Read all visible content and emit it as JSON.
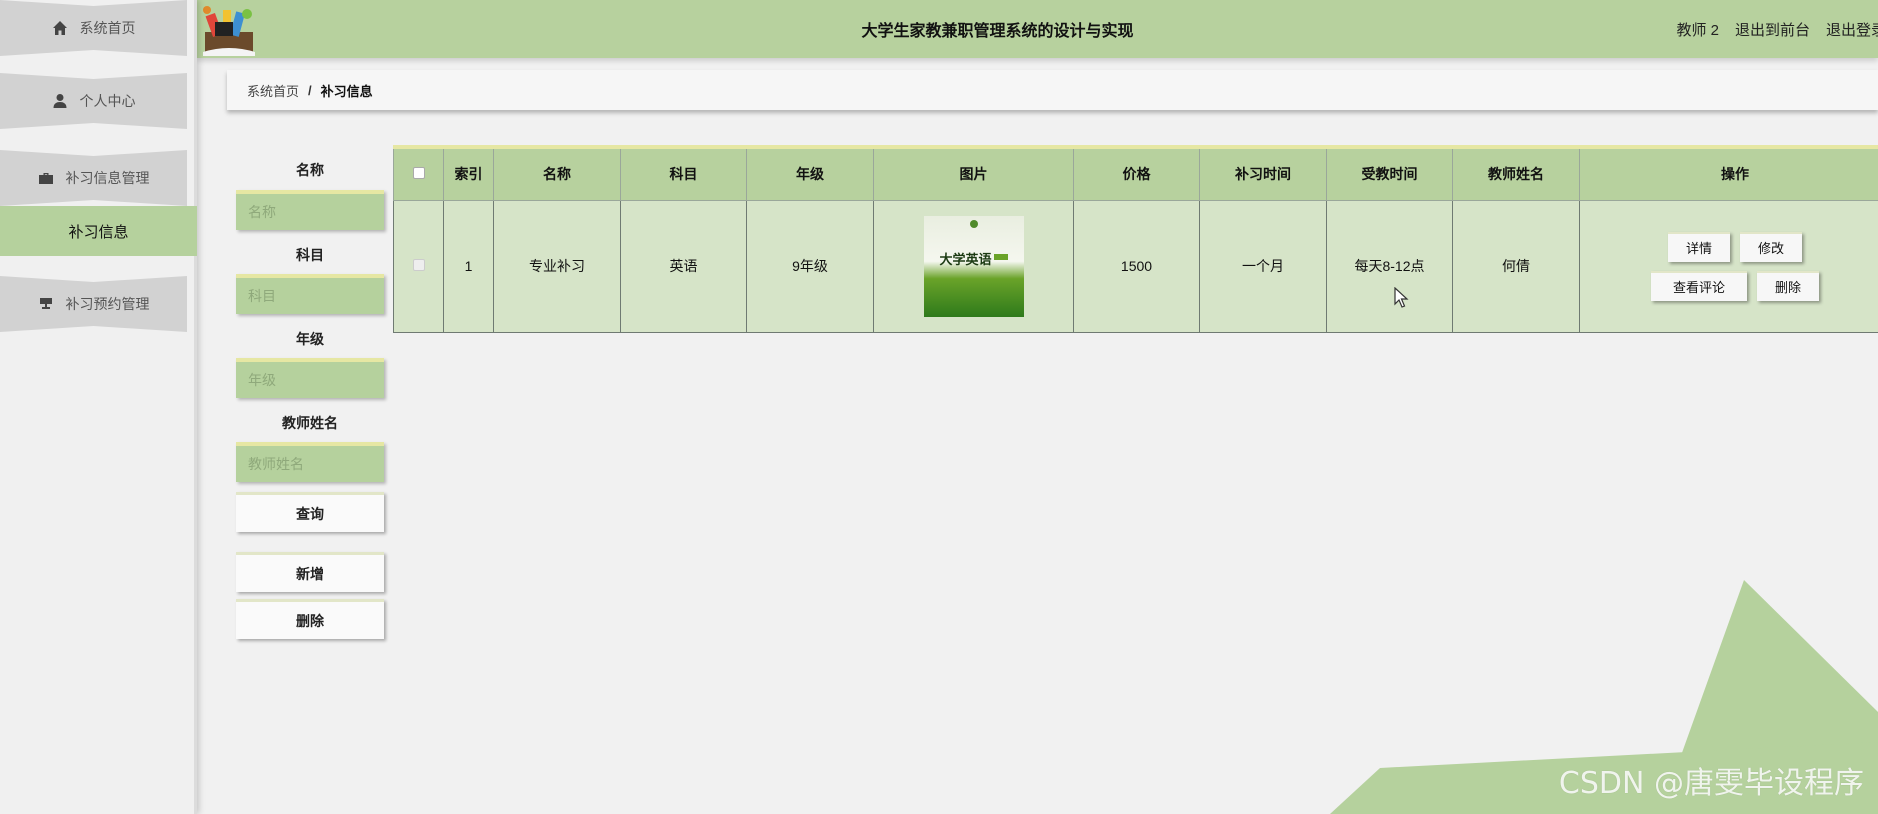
{
  "sidebar": {
    "items": [
      {
        "label": "系统首页",
        "icon": "home-icon"
      },
      {
        "label": "个人中心",
        "icon": "user-icon"
      },
      {
        "label": "补习信息管理",
        "icon": "briefcase-icon"
      },
      {
        "label": "补习预约管理",
        "icon": "desk-icon"
      }
    ],
    "active_sub": "补习信息"
  },
  "header": {
    "title": "大学生家教兼职管理系统的设计与实现",
    "user": "教师 2",
    "exit_front": "退出到前台",
    "logout": "退出登录"
  },
  "breadcrumb": {
    "home": "系统首页",
    "separator": "/",
    "current": "补习信息"
  },
  "search": {
    "fields": [
      {
        "label": "名称",
        "placeholder": "名称"
      },
      {
        "label": "科目",
        "placeholder": "科目"
      },
      {
        "label": "年级",
        "placeholder": "年级"
      },
      {
        "label": "教师姓名",
        "placeholder": "教师姓名"
      }
    ],
    "query_label": "查询",
    "add_label": "新增",
    "delete_label": "删除"
  },
  "table": {
    "headers": [
      "索引",
      "名称",
      "科目",
      "年级",
      "图片",
      "价格",
      "补习时间",
      "受教时间",
      "教师姓名",
      "操作"
    ],
    "rows": [
      {
        "index": "1",
        "name": "专业补习",
        "subject": "英语",
        "grade": "9年级",
        "image_title": "大学英语",
        "price": "1500",
        "duration": "一个月",
        "schedule": "每天8-12点",
        "teacher": "何倩",
        "actions": {
          "detail": "详情",
          "edit": "修改",
          "comments": "查看评论",
          "delete": "删除"
        }
      }
    ]
  },
  "watermark": "CSDN @唐雯毕设程序",
  "colors": {
    "accent_green": "#b7d19e",
    "row_green": "#d6e4c8",
    "input_top": "#e6e7a3"
  }
}
